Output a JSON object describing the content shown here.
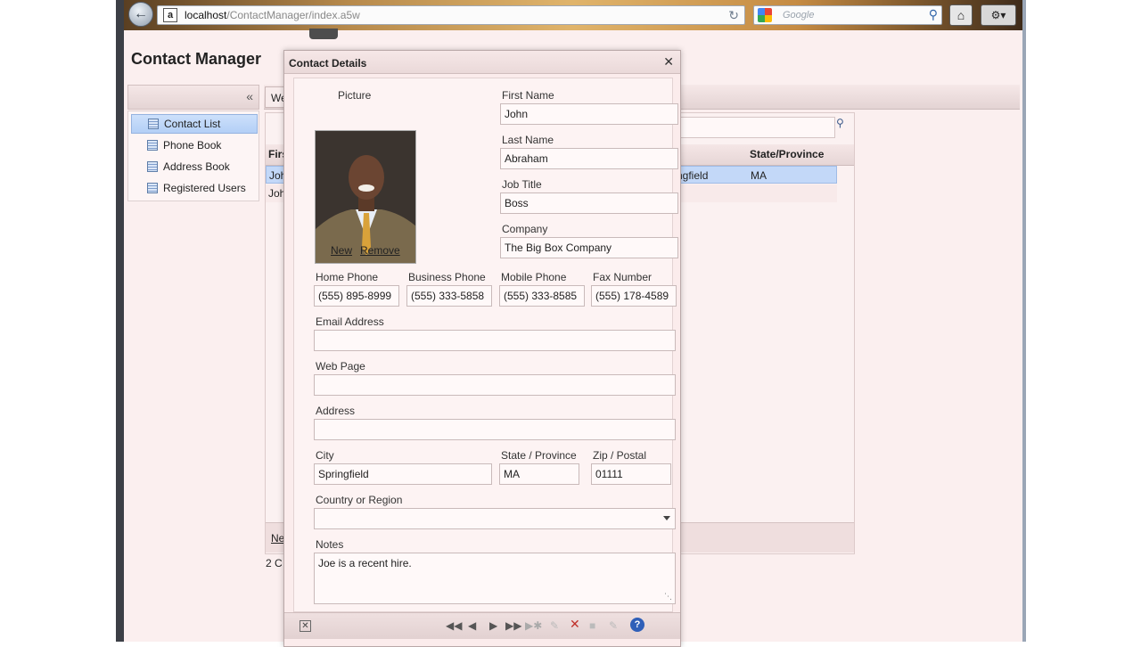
{
  "browser": {
    "url_host": "localhost",
    "url_path": "/ContactManager/index.a5w",
    "search_placeholder": "Google"
  },
  "app": {
    "title": "Contact Manager",
    "nav": {
      "items": [
        {
          "label": "Contact List",
          "active": true
        },
        {
          "label": "Phone Book",
          "active": false
        },
        {
          "label": "Address Book",
          "active": false
        },
        {
          "label": "Registered Users",
          "active": false
        }
      ]
    },
    "tab_fragment": "We",
    "grid": {
      "col_first_fragment": "Firs",
      "col_state": "State/Province",
      "row1_first_fragment": "Joh",
      "row1_city_fragment": "ngfield",
      "row1_state": "MA",
      "row2_first_fragment": "Joh",
      "new_fragment": "Ne",
      "count_fragment": "2 C"
    }
  },
  "modal": {
    "title": "Contact Details",
    "picture_label": "Picture",
    "new_link": "New",
    "remove_link": "Remove",
    "first_name_label": "First Name",
    "first_name": "John",
    "last_name_label": "Last Name",
    "last_name": "Abraham",
    "job_title_label": "Job Title",
    "job_title": "Boss",
    "company_label": "Company",
    "company": "The Big Box Company",
    "home_phone_label": "Home Phone",
    "home_phone": "(555) 895-8999",
    "business_phone_label": "Business Phone",
    "business_phone": "(555) 333-5858",
    "mobile_phone_label": "Mobile Phone",
    "mobile_phone": "(555) 333-8585",
    "fax_label": "Fax Number",
    "fax": "(555) 178-4589",
    "email_label": "Email Address",
    "email": "",
    "web_label": "Web Page",
    "web": "",
    "address_label": "Address",
    "address": "",
    "city_label": "City",
    "city": "Springfield",
    "state_label": "State / Province",
    "state": "MA",
    "zip_label": "Zip / Postal",
    "zip": "01111",
    "country_label": "Country or Region",
    "country": "",
    "notes_label": "Notes",
    "notes": "Joe is a recent hire."
  }
}
